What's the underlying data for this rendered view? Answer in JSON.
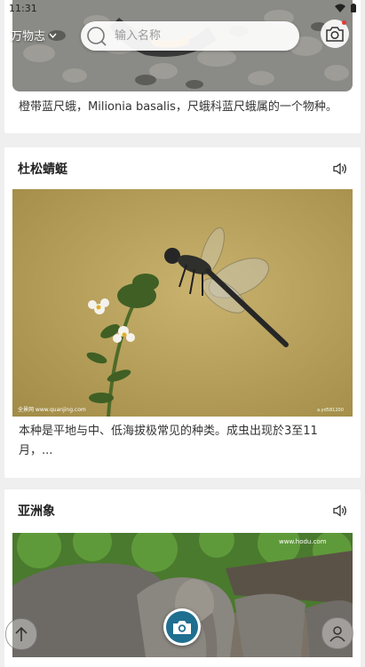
{
  "status_bar": {
    "time": "11:31"
  },
  "top_bar": {
    "location_label": "万物志",
    "search_placeholder": "输入名称"
  },
  "cards": [
    {
      "title": "",
      "description": "橙带蓝尺蛾，Milionia basalis，尺蛾科蓝尺蛾属的一个物种。"
    },
    {
      "title": "杜松蜻蜓",
      "description": "本种是平地与中、低海拔极常见的种类。成虫出现於3至11月，...",
      "image_watermark_left": "全景网 www.quanjing.com",
      "image_watermark_right": "a.yd581200"
    },
    {
      "title": "亚洲象",
      "image_watermark": "www.hodu.com"
    }
  ]
}
